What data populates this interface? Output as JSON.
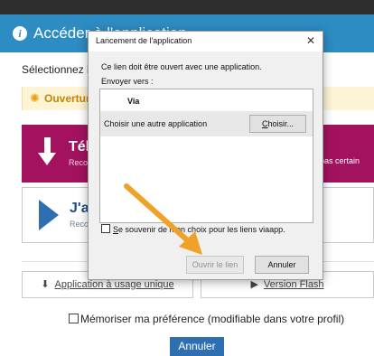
{
  "header": {
    "title": "Accéder à l'application",
    "info_icon": "info-icon"
  },
  "background": {
    "select_text": "Sélectionnez la",
    "warning": {
      "text": "Ouvertur",
      "icon": "sun-icon"
    },
    "download_card": {
      "title": "Télé",
      "subtitle": "Reco",
      "side_text": "pas certain"
    },
    "installed_card": {
      "title": "J'ai",
      "subtitle": "Reco"
    },
    "buttons": {
      "single_use": "Application à usage unique",
      "flash": "Version Flash"
    },
    "remember_label": "Mémoriser ma préférence (modifiable dans votre profil)",
    "cancel_label": "Annuler"
  },
  "dialog": {
    "title": "Lancement de l'application",
    "close_glyph": "✕",
    "message": "Ce lien doit être ouvert avec une application.",
    "send_to": "Envoyer vers :",
    "apps": [
      {
        "label": "Via"
      },
      {
        "label": "Choisir une autre application",
        "button": "Choisir...",
        "button_underline": "C",
        "button_rest": "hoisir..."
      }
    ],
    "remember": {
      "underline": "S",
      "rest": "e souvenir de mon choix pour les liens viaapp."
    },
    "open_button": "Ouvrir le lien",
    "cancel_button": "Annuler"
  },
  "colors": {
    "header": "#2d8cc2",
    "purple": "#a3125f",
    "accent": "#2d6fb0",
    "pointer_arrow": "#f0a127"
  }
}
